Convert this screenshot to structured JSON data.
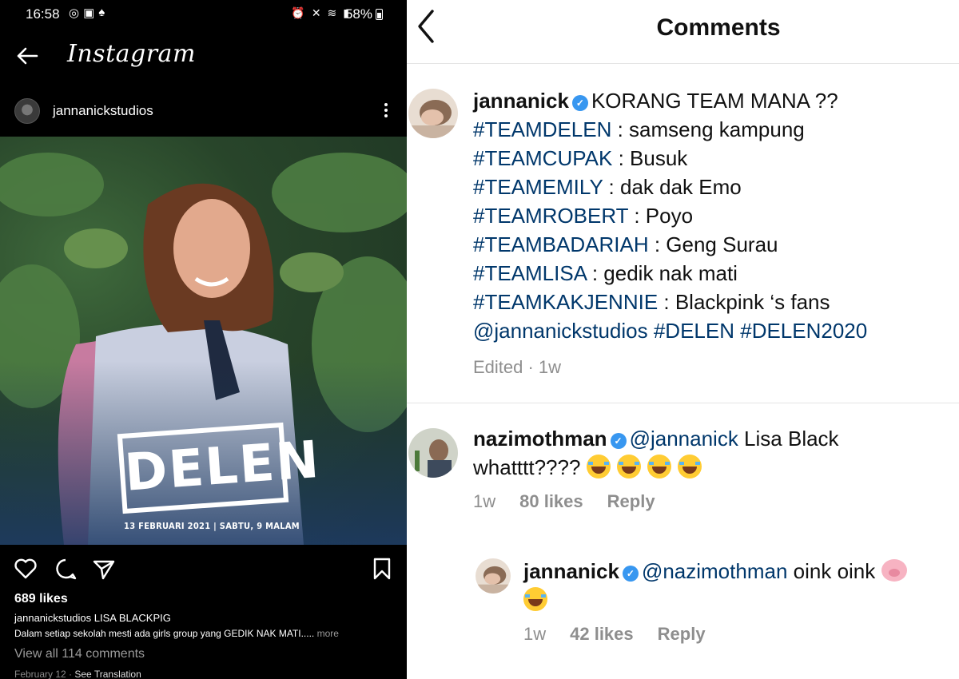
{
  "status_bar": {
    "time": "16:58",
    "battery": "58%"
  },
  "ig_header": {
    "logo_text": "Instagram"
  },
  "post": {
    "username": "jannanickstudios",
    "image": {
      "title_text": "DELEN",
      "date_text": "13 FEBRUARI 2021  |  SABTU, 9 MALAM"
    },
    "likes": "689 likes",
    "caption_user": "jannanickstudios",
    "caption_text": "LISA BLACKPIG",
    "caption_line2": "Dalam setiap sekolah mesti ada girls group yang GEDIK NAK MATI..... ",
    "more_label": "more",
    "view_all": "View all 114 comments",
    "date": "February 12",
    "see_translation": "See Translation"
  },
  "comments_page": {
    "title": "Comments",
    "main_comment": {
      "username": "jannanick",
      "lines": [
        {
          "tag": "",
          "text": "KORANG TEAM MANA ??"
        },
        {
          "tag": "#TEAMDELEN",
          "text": " : samseng kampung"
        },
        {
          "tag": "#TEAMCUPAK",
          "text": " : Busuk"
        },
        {
          "tag": "#TEAMEMILY",
          "text": " : dak dak Emo"
        },
        {
          "tag": "#TEAMROBERT",
          "text": " : Poyo"
        },
        {
          "tag": "#TEAMBADARIAH",
          "text": " : Geng Surau"
        },
        {
          "tag": "#TEAMLISA",
          "text": " : gedik nak mati"
        },
        {
          "tag": "#TEAMKAKJENNIE",
          "text": " : Blackpink ‘s fans"
        }
      ],
      "last_line": "@jannanickstudios #DELEN #DELEN2020",
      "meta": "Edited · 1w"
    },
    "reply1": {
      "username": "nazimothman",
      "mention": "@jannanick",
      "text1": " Lisa Black",
      "text2": "whatttt????",
      "time": "1w",
      "likes": "80 likes",
      "reply_label": "Reply"
    },
    "reply2": {
      "username": "jannanick",
      "mention": "@nazimothman",
      "text": " oink oink",
      "time": "1w",
      "likes": "42 likes",
      "reply_label": "Reply"
    }
  }
}
